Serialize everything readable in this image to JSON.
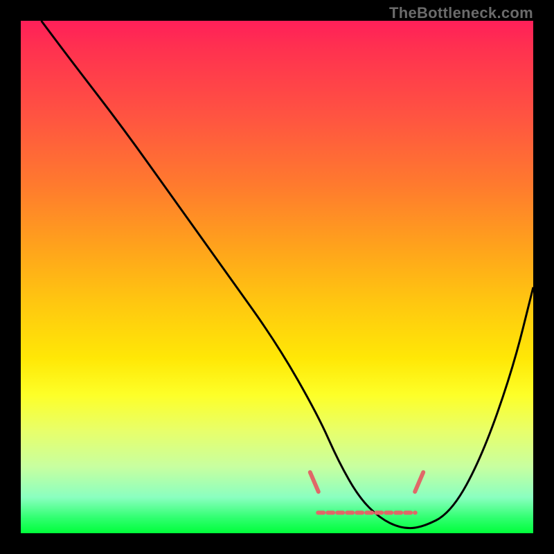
{
  "watermark": "TheBottleneck.com",
  "colors": {
    "frame_background": "#000000",
    "gradient_top": "#ff1f59",
    "gradient_mid_orange": "#ff7a2e",
    "gradient_mid_yellow": "#ffe806",
    "gradient_bottom": "#00ff3a",
    "curve_stroke": "#000000",
    "marker_stroke": "#e06868"
  },
  "chart_data": {
    "type": "line",
    "title": "",
    "xlabel": "",
    "ylabel": "",
    "xlim": [
      0,
      100
    ],
    "ylim": [
      0,
      100
    ],
    "grid": false,
    "legend": false,
    "series": [
      {
        "name": "bottleneck-curve",
        "x": [
          4,
          10,
          20,
          30,
          40,
          50,
          58,
          62,
          66,
          70,
          74,
          78,
          84,
          90,
          96,
          100
        ],
        "values": [
          100,
          92,
          79,
          65,
          51,
          37,
          23,
          14,
          7,
          3,
          1,
          1,
          4,
          15,
          32,
          48
        ]
      }
    ],
    "markers": [
      {
        "name": "marker-left",
        "x": 57,
        "y": 10
      },
      {
        "name": "marker-right",
        "x": 78,
        "y": 10
      },
      {
        "name": "flat-segment",
        "x_start": 58,
        "x_end": 77,
        "y": 4
      }
    ],
    "annotations": []
  }
}
